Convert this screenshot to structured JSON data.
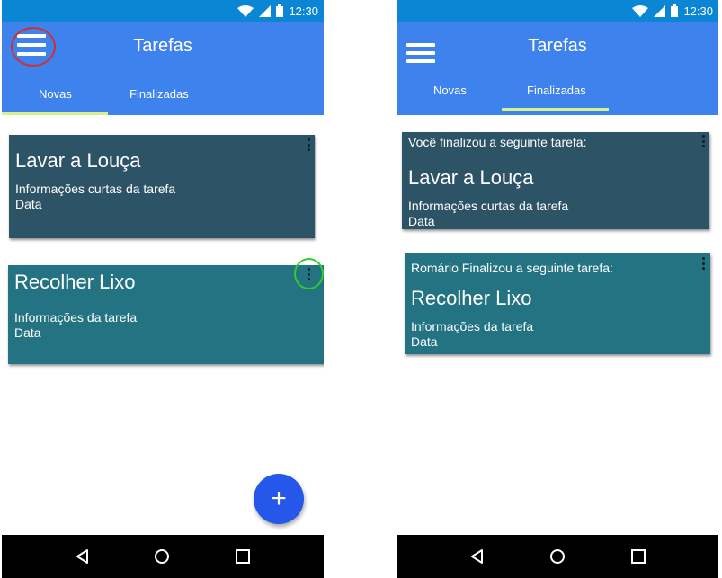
{
  "left_screen": {
    "status_time": "12:30",
    "title": "Tarefas",
    "tabs": [
      {
        "label": "Novas",
        "active": true
      },
      {
        "label": "Finalizadas",
        "active": false
      }
    ],
    "cards": [
      {
        "title": "Lavar a Louça",
        "info": "Informações curtas da tarefa",
        "date": "Data",
        "color": "#2d5366"
      },
      {
        "title": "Recolher Lixo",
        "info": "Informações da tarefa",
        "date": "Data",
        "color": "#237382"
      }
    ],
    "fab_label": "+",
    "highlight_colors": {
      "menu": "#d32f2f",
      "card_menu": "#2ecc2e"
    }
  },
  "right_screen": {
    "status_time": "12:30",
    "title": "Tarefas",
    "tabs": [
      {
        "label": "Novas",
        "active": false
      },
      {
        "label": "Finalizadas",
        "active": true
      }
    ],
    "cards": [
      {
        "heading": "Você finalizou a seguinte tarefa:",
        "title": "Lavar a Louça",
        "info": "Informações curtas da tarefa",
        "date": "Data",
        "color": "#2d5366"
      },
      {
        "heading": "Romário Finalizou a seguinte tarefa:",
        "title": "Recolher Lixo",
        "info": "Informações da tarefa",
        "date": "Data",
        "color": "#237382"
      }
    ]
  },
  "icons": {
    "wifi": "wifi-icon",
    "signal": "signal-icon",
    "battery": "battery-icon",
    "menu": "menu-icon",
    "more": "more-vert-icon",
    "add": "add-icon",
    "back": "back-icon",
    "home": "home-icon",
    "recents": "recents-icon"
  },
  "colors": {
    "status_bar": "#0b86d4",
    "app_bar": "#3d82ed",
    "tab_indicator": "#d7f08e",
    "fab": "#2457ea",
    "nav_bar": "#000000"
  }
}
